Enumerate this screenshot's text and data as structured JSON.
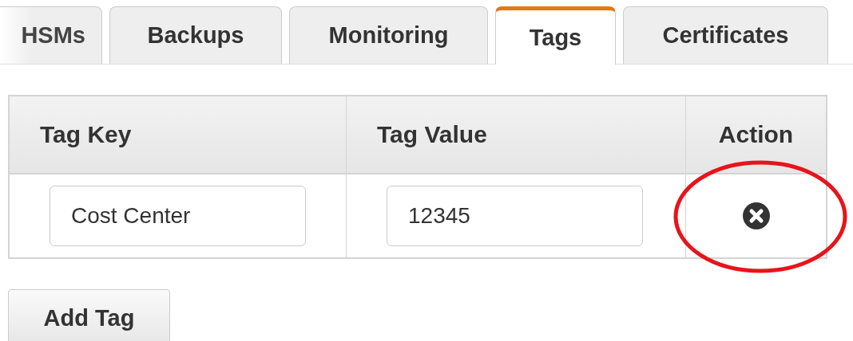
{
  "tabs": [
    {
      "label": "HSMs",
      "selected": false
    },
    {
      "label": "Backups",
      "selected": false
    },
    {
      "label": "Monitoring",
      "selected": false
    },
    {
      "label": "Tags",
      "selected": true
    },
    {
      "label": "Certificates",
      "selected": false
    }
  ],
  "table": {
    "columns": [
      "Tag Key",
      "Tag Value",
      "Action"
    ],
    "rows": [
      {
        "key": "Cost Center",
        "value": "12345",
        "highlighted": true
      }
    ]
  },
  "add_button": "Add Tag"
}
